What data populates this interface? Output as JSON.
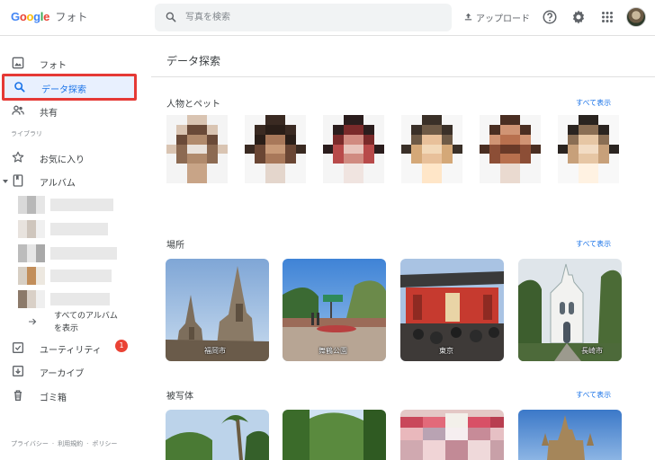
{
  "header": {
    "logo_letters": [
      "G",
      "o",
      "o",
      "g",
      "l",
      "e"
    ],
    "logo_service": "フォト",
    "search_placeholder": "写真を検索",
    "upload_label": "アップロード"
  },
  "sidebar": {
    "items": [
      {
        "label": "フォト",
        "icon": "photo-icon"
      },
      {
        "label": "データ探索",
        "icon": "search-icon",
        "active": true
      },
      {
        "label": "共有",
        "icon": "people-icon"
      }
    ],
    "library_label": "ライブラリ",
    "library_items": [
      {
        "label": "お気に入り",
        "icon": "star-icon"
      },
      {
        "label": "アルバム",
        "icon": "album-icon"
      }
    ],
    "all_albums_line1": "すべてのアルバム",
    "all_albums_line2": "を表示",
    "more_items": [
      {
        "label": "ユーティリティ",
        "icon": "utilities-icon",
        "badge": "1"
      },
      {
        "label": "アーカイブ",
        "icon": "archive-icon"
      },
      {
        "label": "ゴミ箱",
        "icon": "trash-icon"
      }
    ],
    "footer": [
      "プライバシー",
      "利用規約",
      "ポリシー"
    ]
  },
  "main": {
    "title": "データ探索",
    "people": {
      "title": "人物とペット",
      "see_all": "すべて表示"
    },
    "places": {
      "title": "場所",
      "see_all": "すべて表示",
      "items": [
        {
          "label": "福岡市"
        },
        {
          "label": "舞鶴公園"
        },
        {
          "label": "東京"
        },
        {
          "label": "長崎市"
        }
      ]
    },
    "things": {
      "title": "被写体",
      "see_all": "すべて表示"
    }
  },
  "colors": {
    "accent": "#1a73e8",
    "active_bg": "#e8f0fe",
    "highlight_border": "#e53935",
    "badge": "#ea4335"
  }
}
